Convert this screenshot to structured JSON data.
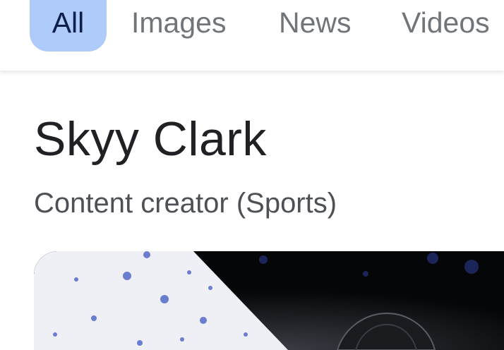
{
  "tabs": [
    {
      "label": "All",
      "selected": true
    },
    {
      "label": "Images",
      "selected": false
    },
    {
      "label": "News",
      "selected": false
    },
    {
      "label": "Videos",
      "selected": false
    }
  ],
  "knowledge_panel": {
    "title": "Skyy Clark",
    "subtitle": "Content creator (Sports)"
  },
  "colors": {
    "selected_tab_bg": "#aecbfa",
    "selected_tab_text": "#0b1f4a",
    "tab_text": "#70757a",
    "title_text": "#202124",
    "subtitle_text": "#4d5156"
  }
}
